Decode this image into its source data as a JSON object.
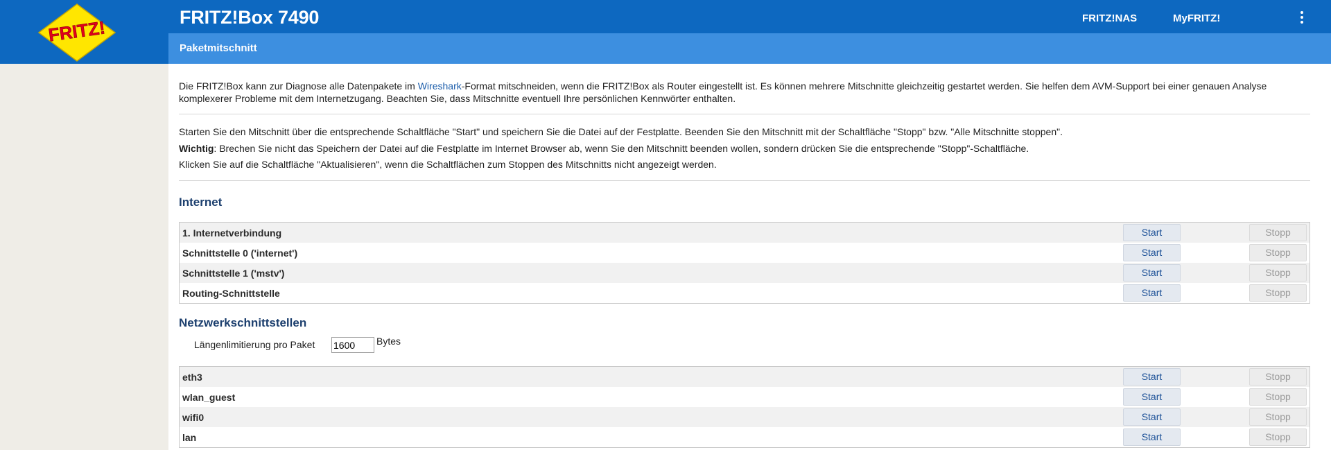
{
  "header": {
    "title": "FRITZ!Box 7490",
    "links": [
      "FRITZ!NAS",
      "MyFRITZ!"
    ],
    "logo_text": "FRITZ!"
  },
  "subheader": {
    "title": "Paketmitschnitt"
  },
  "intro": {
    "before_link": "Die FRITZ!Box kann zur Diagnose alle Datenpakete im ",
    "link": "Wireshark",
    "after_link": "-Format mitschneiden, wenn die FRITZ!Box als Router eingestellt ist. Es können mehrere Mitschnitte gleichzeitig gestartet werden. Sie helfen dem AVM-Support bei einer genauen Analyse komplexerer Probleme mit dem Internetzugang. Beachten Sie, dass Mitschnitte eventuell Ihre persönlichen Kennwörter enthalten."
  },
  "instructions": {
    "line1": "Starten Sie den Mitschnitt über die entsprechende Schaltfläche \"Start\" und speichern Sie die Datei auf der Festplatte. Beenden Sie den Mitschnitt mit der Schaltfläche \"Stopp\" bzw. \"Alle Mitschnitte stoppen\".",
    "line2_bold": "Wichtig",
    "line2_rest": ": Brechen Sie nicht das Speichern der Datei auf die Festplatte im Internet Browser ab, wenn Sie den Mitschnitt beenden wollen, sondern drücken Sie die entsprechende \"Stopp\"-Schaltfläche.",
    "line3": "Klicken Sie auf die Schaltfläche \"Aktualisieren\", wenn die Schaltflächen zum Stoppen des Mitschnitts nicht angezeigt werden."
  },
  "buttons": {
    "start": "Start",
    "stopp": "Stopp"
  },
  "internet": {
    "title": "Internet",
    "rows": [
      "1. Internetverbindung",
      "Schnittstelle 0 ('internet')",
      "Schnittstelle 1 ('mstv')",
      "Routing-Schnittstelle"
    ]
  },
  "network": {
    "title": "Netzwerkschnittstellen",
    "length_label": "Längenlimitierung pro Paket",
    "length_value": "1600",
    "length_unit": "Bytes",
    "rows": [
      "eth3",
      "wlan_guest",
      "wifi0",
      "lan"
    ]
  },
  "colors": {
    "header_blue": "#0d68c0",
    "subheader_blue": "#3d8fe0",
    "logo_red": "#e2001a",
    "logo_yellow": "#ffe600"
  }
}
